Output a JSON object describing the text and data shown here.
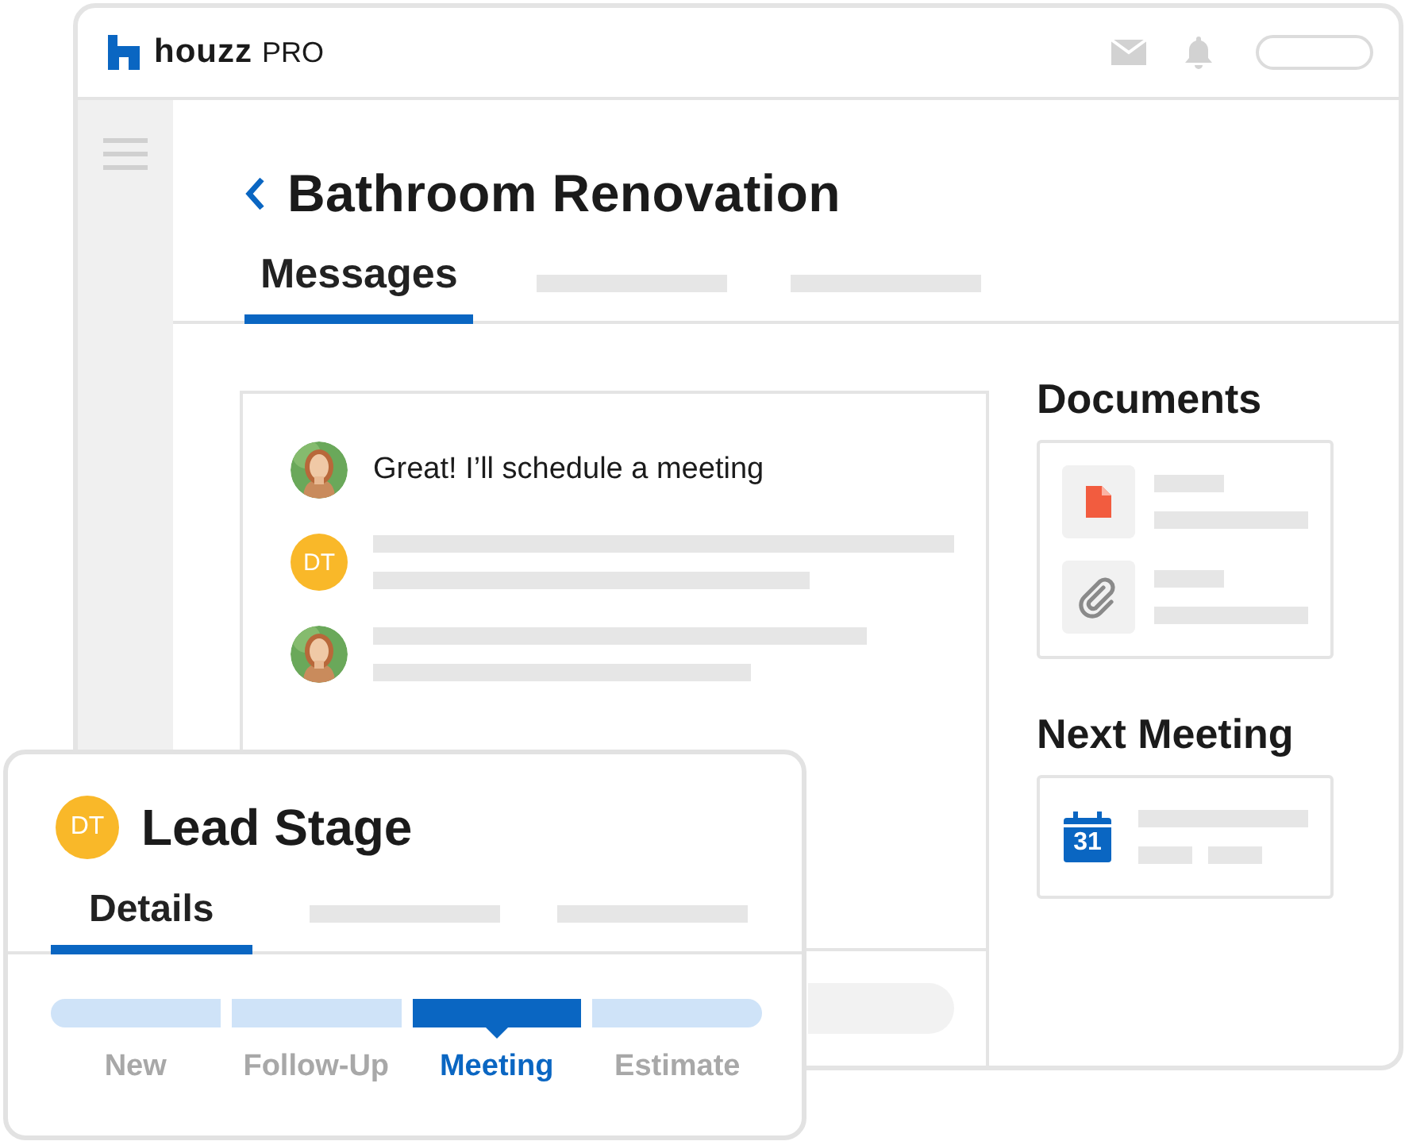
{
  "header": {
    "logo": "houzz",
    "logo_suffix": "PRO"
  },
  "project": {
    "title": "Bathroom Renovation"
  },
  "tabs": [
    {
      "label": "Messages",
      "selected": true
    }
  ],
  "messages": [
    {
      "avatar": {
        "kind": "picture"
      },
      "text": "Great! I’ll schedule a meeting"
    },
    {
      "avatar": {
        "kind": "initials",
        "initials": "DT"
      }
    },
    {
      "avatar": {
        "kind": "picture"
      }
    }
  ],
  "documents": {
    "title": "Documents",
    "items": [
      {
        "kind": "file"
      },
      {
        "kind": "attachment"
      }
    ]
  },
  "next_meeting": {
    "title": "Next Meeting",
    "calendar_day": "31"
  },
  "lead_card": {
    "initials": "DT",
    "title": "Lead Stage",
    "tabs": [
      {
        "label": "Details",
        "selected": true
      }
    ],
    "stages": [
      {
        "label": "New",
        "selected": false
      },
      {
        "label": "Follow-Up",
        "selected": false
      },
      {
        "label": "Meeting",
        "selected": true
      },
      {
        "label": "Estimate",
        "selected": false
      }
    ]
  }
}
